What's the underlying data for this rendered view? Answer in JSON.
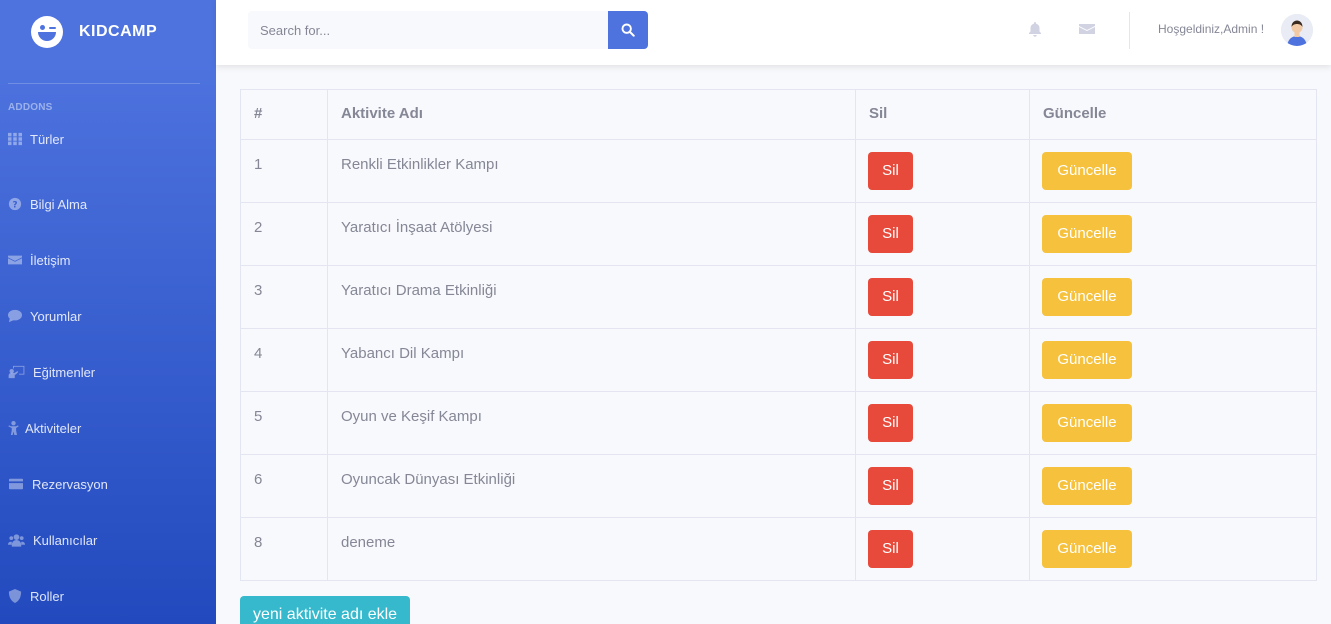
{
  "brand": {
    "name": "KIDCAMP"
  },
  "sidebar": {
    "heading": "ADDONS",
    "items": [
      {
        "label": "Türler",
        "icon": "grid-icon"
      },
      {
        "label": "Bilgi Alma",
        "icon": "question-circle-icon"
      },
      {
        "label": "İletişim",
        "icon": "envelope-icon"
      },
      {
        "label": "Yorumlar",
        "icon": "comment-icon"
      },
      {
        "label": "Eğitmenler",
        "icon": "chalkboard-teacher-icon"
      },
      {
        "label": "Aktiviteler",
        "icon": "child-icon"
      },
      {
        "label": "Rezervasyon",
        "icon": "credit-card-icon"
      },
      {
        "label": "Kullanıcılar",
        "icon": "users-icon"
      },
      {
        "label": "Roller",
        "icon": "shield-icon"
      }
    ]
  },
  "topbar": {
    "search_placeholder": "Search for...",
    "user_greeting": "Hoşgeldiniz,Admin !"
  },
  "table": {
    "headers": [
      "#",
      "Aktivite Adı",
      "Sil",
      "Güncelle"
    ],
    "rows": [
      {
        "id": "1",
        "name": "Renkli Etkinlikler Kampı",
        "delete_label": "Sil",
        "update_label": "Güncelle"
      },
      {
        "id": "2",
        "name": "Yaratıcı İnşaat Atölyesi",
        "delete_label": "Sil",
        "update_label": "Güncelle"
      },
      {
        "id": "3",
        "name": "Yaratıcı Drama Etkinliği",
        "delete_label": "Sil",
        "update_label": "Güncelle"
      },
      {
        "id": "4",
        "name": "Yabancı Dil Kampı",
        "delete_label": "Sil",
        "update_label": "Güncelle"
      },
      {
        "id": "5",
        "name": "Oyun ve Keşif Kampı",
        "delete_label": "Sil",
        "update_label": "Güncelle"
      },
      {
        "id": "6",
        "name": "Oyuncak Dünyası Etkinliği",
        "delete_label": "Sil",
        "update_label": "Güncelle"
      },
      {
        "id": "8",
        "name": "deneme",
        "delete_label": "Sil",
        "update_label": "Güncelle"
      }
    ]
  },
  "add_button": {
    "label": "yeni aktivite adı ekle"
  },
  "colors": {
    "primary": "#4e73df",
    "danger": "#e74a3b",
    "warning": "#f6c23e",
    "info": "#36b9cc"
  }
}
